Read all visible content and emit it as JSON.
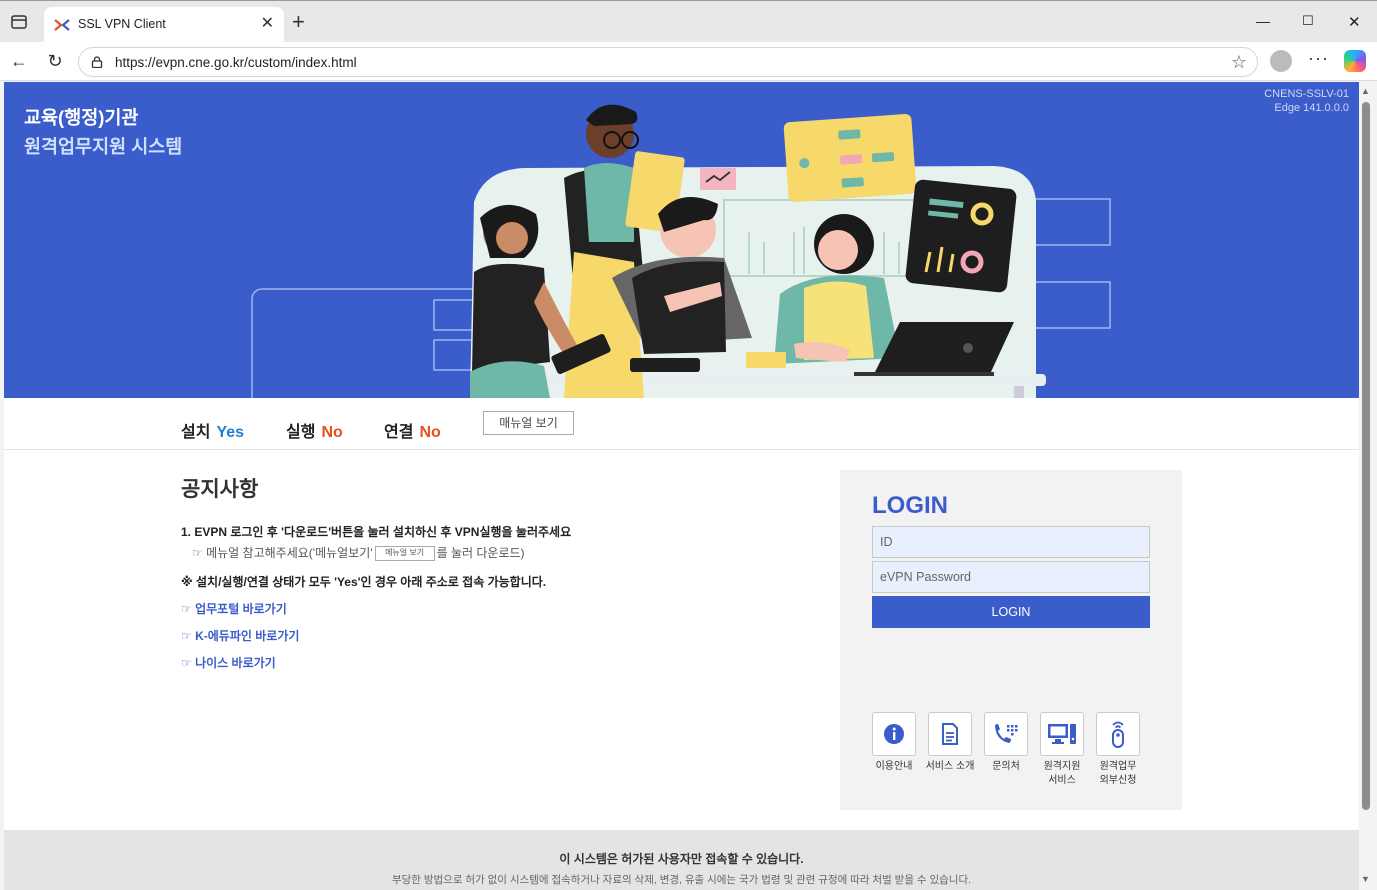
{
  "browser": {
    "tab_title": "SSL VPN Client",
    "url": "https://evpn.cne.go.kr/custom/index.html"
  },
  "hero": {
    "title_line1": "교육(행정)기관",
    "title_line2": "원격업무지원 시스템",
    "server_name": "CNENS-SSLV-01",
    "browser_version": "Edge 141.0.0.0"
  },
  "status": {
    "install_label": "설치",
    "install_value": "Yes",
    "run_label": "실행",
    "run_value": "No",
    "connect_label": "연결",
    "connect_value": "No",
    "manual_button": "매뉴얼 보기"
  },
  "notice": {
    "title": "공지사항",
    "item1": "1. EVPN 로그인 후 '다운로드'버튼을 눌러 설치하신 후 VPN실행을 눌러주세요",
    "item1_sub_prefix": "☞ 메뉴얼 참고해주세요('메뉴얼보기'",
    "item1_sub_button": "메뉴얼 보기",
    "item1_sub_suffix": "를 눌러 다운로드)",
    "item2": "※ 설치/실행/연결 상태가 모두 'Yes'인 경우 아래 주소로 접속 가능합니다.",
    "links": [
      "☞ 업무포털 바로가기",
      "☞ K-에듀파인 바로가기",
      "☞ 나이스 바로가기"
    ]
  },
  "login": {
    "title": "LOGIN",
    "id_placeholder": "ID",
    "password_placeholder": "eVPN Password",
    "button": "LOGIN"
  },
  "quick_menu": [
    {
      "label": "이용안내",
      "icon": "info-icon"
    },
    {
      "label": "서비스 소개",
      "icon": "document-icon"
    },
    {
      "label": "문의처",
      "icon": "phone-icon"
    },
    {
      "label": "원격지원\n서비스",
      "icon": "monitor-icon"
    },
    {
      "label": "원격업무\n외부신청",
      "icon": "remote-icon"
    }
  ],
  "footer": {
    "line1": "이 시스템은 허가된 사용자만 접속할 수 있습니다.",
    "line2": "부당한 방법으로 허가 없이 시스템에 접속하거나 자료의 삭제, 변경, 유출 시에는 국가 법령 및 관련 규정에 따라 처벌 받을 수 있습니다."
  },
  "colors": {
    "brand_blue": "#3b5ccb",
    "yes": "#1f7fd6",
    "no": "#e8501c"
  }
}
